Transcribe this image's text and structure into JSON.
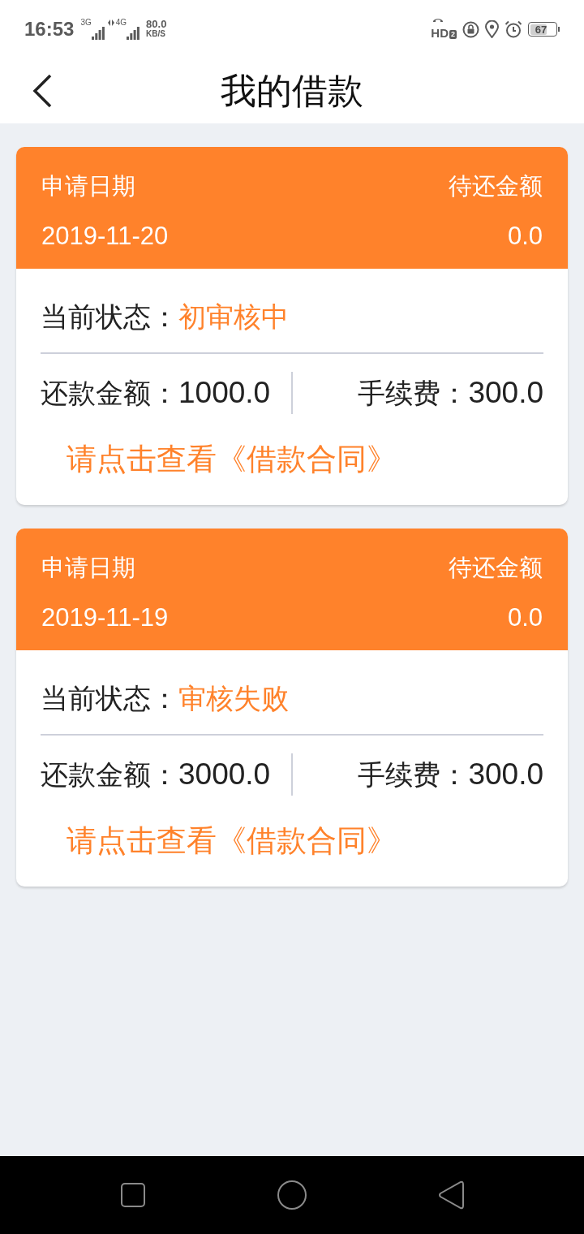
{
  "status_bar": {
    "time": "16:53",
    "networks": [
      {
        "label": "3G"
      },
      {
        "label": "4G"
      }
    ],
    "speed": "80.0",
    "speed_unit": "KB/S",
    "hd": "HD",
    "hd_sub": "2",
    "battery": "67"
  },
  "header": {
    "title": "我的借款"
  },
  "loans": [
    {
      "date_label": "申请日期",
      "date": "2019-11-20",
      "due_label": "待还金额",
      "due": "0.0",
      "status_label": "当前状态：",
      "status": "初审核中",
      "amount_label": "还款金额：",
      "amount": "1000.0",
      "fee_label": "手续费：",
      "fee": "300.0",
      "link": "请点击查看《借款合同》"
    },
    {
      "date_label": "申请日期",
      "date": "2019-11-19",
      "due_label": "待还金额",
      "due": "0.0",
      "status_label": "当前状态：",
      "status": "审核失败",
      "amount_label": "还款金额：",
      "amount": "3000.0",
      "fee_label": "手续费：",
      "fee": "300.0",
      "link": "请点击查看《借款合同》"
    }
  ]
}
